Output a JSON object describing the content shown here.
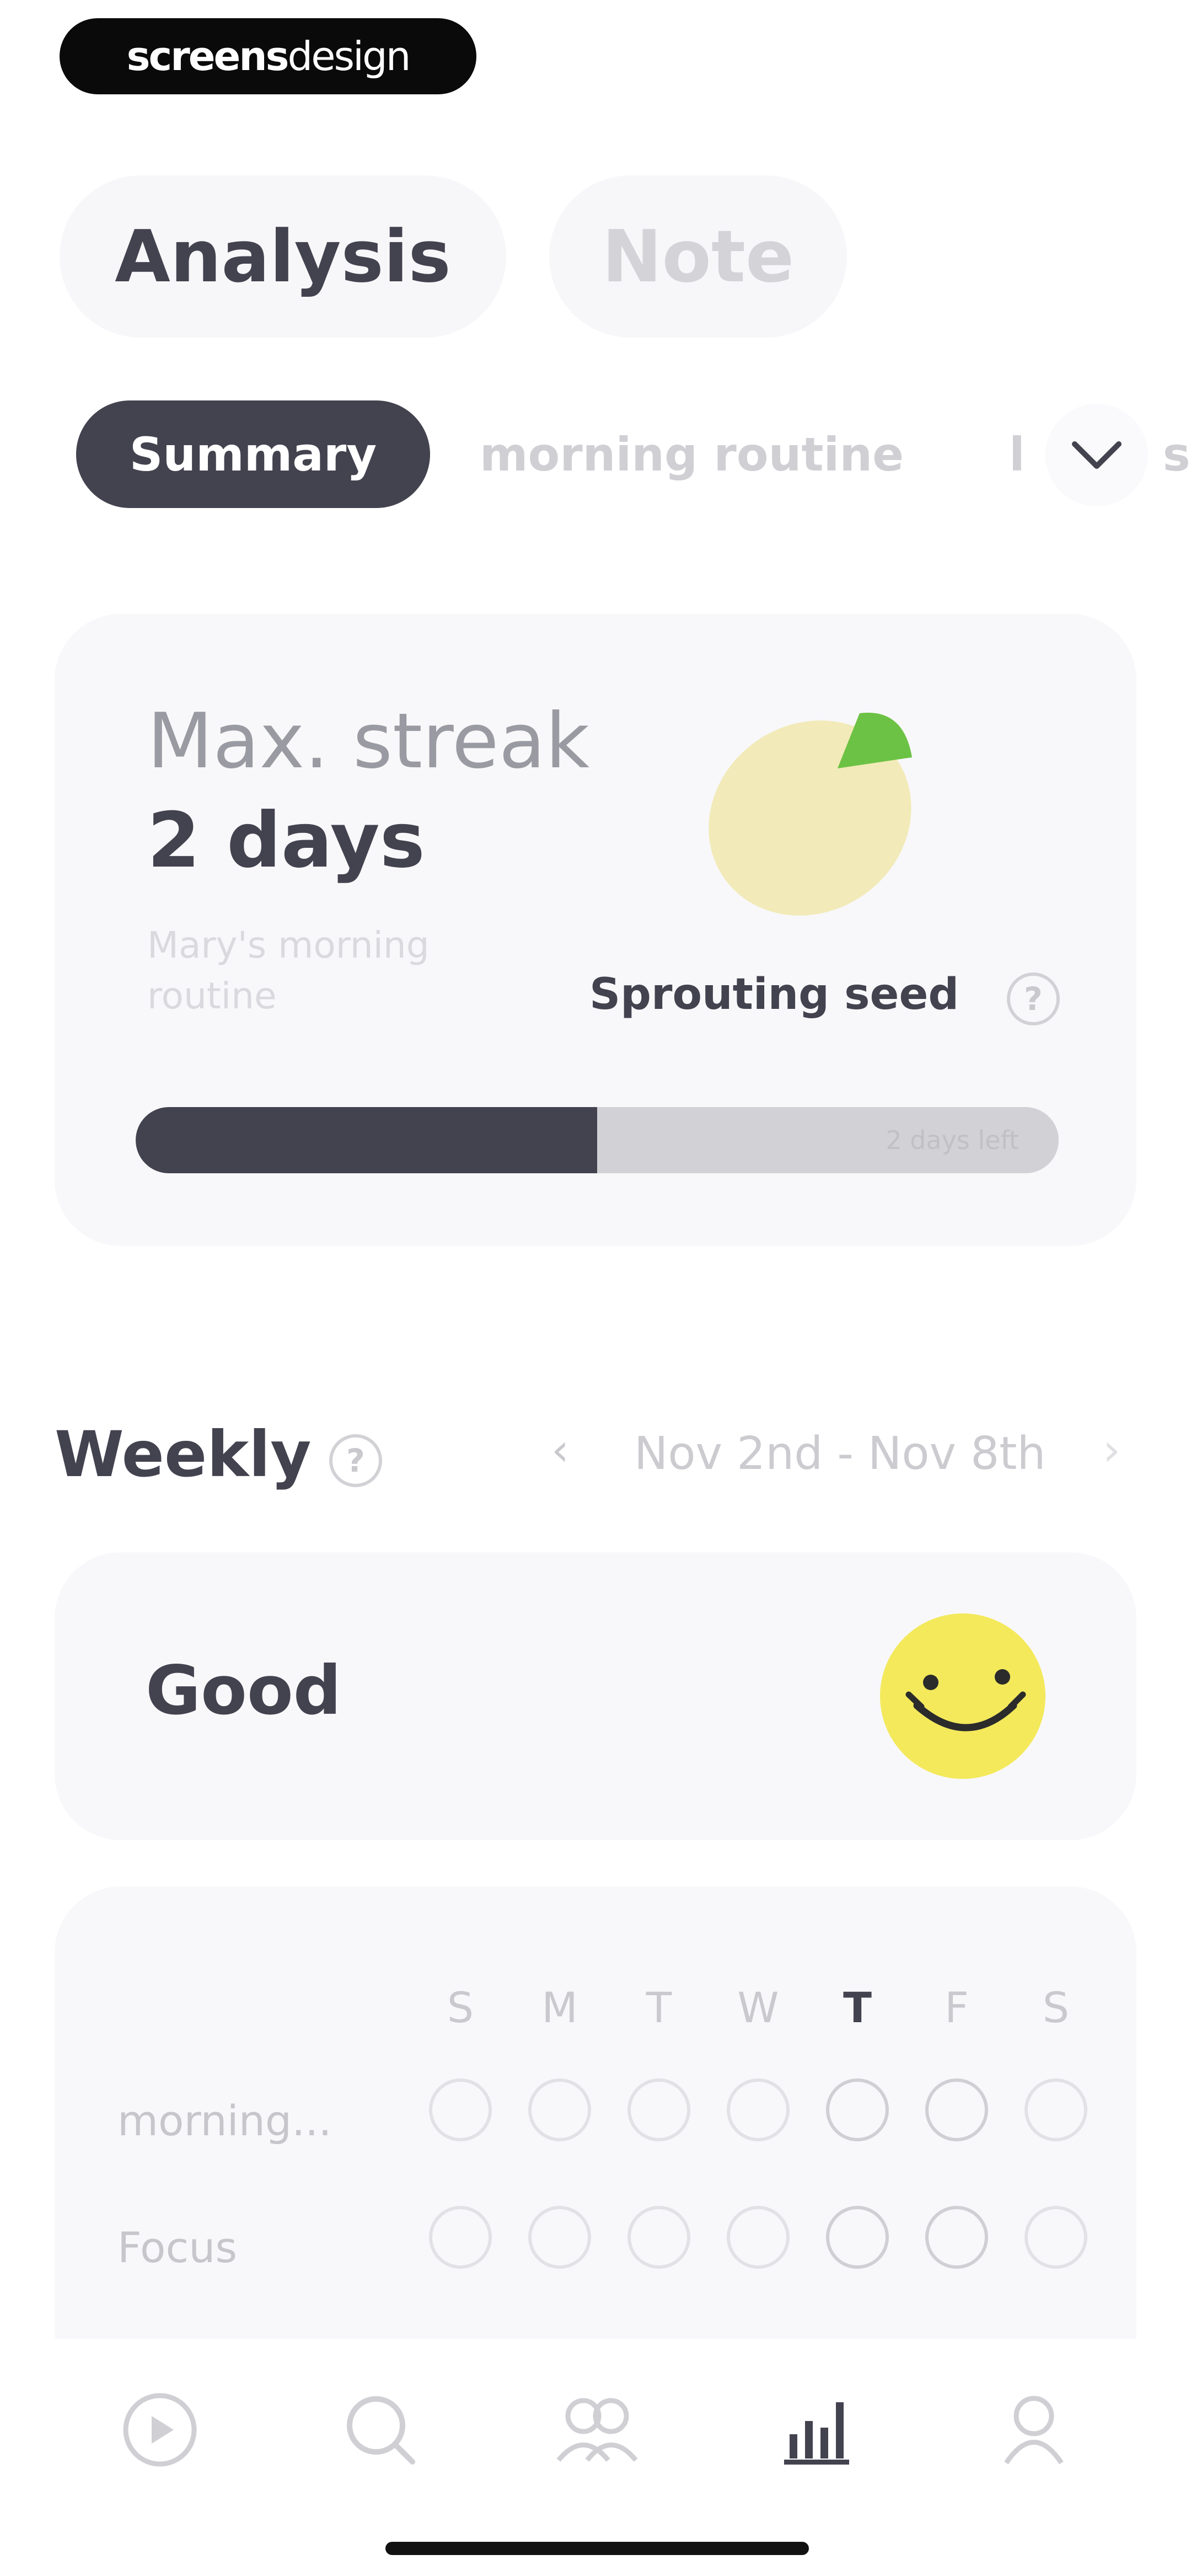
{
  "watermark": {
    "bold": "screens",
    "light": "design"
  },
  "top_tabs": [
    {
      "label": "Analysis",
      "active": true
    },
    {
      "label": "Note",
      "active": false
    }
  ],
  "chips": [
    {
      "label": "Summary",
      "active": true
    },
    {
      "label": "morning routine",
      "active": false
    },
    {
      "label": "l",
      "active": false
    },
    {
      "label": "s",
      "active": false
    }
  ],
  "streak": {
    "label": "Max. streak",
    "value": "2 days",
    "subtitle": "Mary's morning routine",
    "stage": "Sprouting seed",
    "progress": 0.5,
    "progress_text": "2 days left"
  },
  "weekly": {
    "title": "Weekly",
    "range": "Nov 2nd - Nov 8th",
    "prev_icon": "chevron-left-icon",
    "next_icon": "chevron-right-icon"
  },
  "mood": {
    "label": "Good",
    "icon": "smiley-face-icon",
    "color": "#f3e95b"
  },
  "habit_grid": {
    "days": [
      "S",
      "M",
      "T",
      "W",
      "T",
      "F",
      "S"
    ],
    "today_index": 4,
    "rows": [
      {
        "name": "morning..."
      },
      {
        "name": "Focus"
      }
    ]
  },
  "tabbar": [
    {
      "icon": "play-icon",
      "active": false
    },
    {
      "icon": "search-icon",
      "active": false
    },
    {
      "icon": "community-icon",
      "active": false
    },
    {
      "icon": "bar-chart-icon",
      "active": true
    },
    {
      "icon": "profile-icon",
      "active": false
    }
  ],
  "colors": {
    "primary": "#43424f",
    "seed": "#f2eab8",
    "sprout": "#6cc244",
    "card": "#f8f8fa"
  }
}
